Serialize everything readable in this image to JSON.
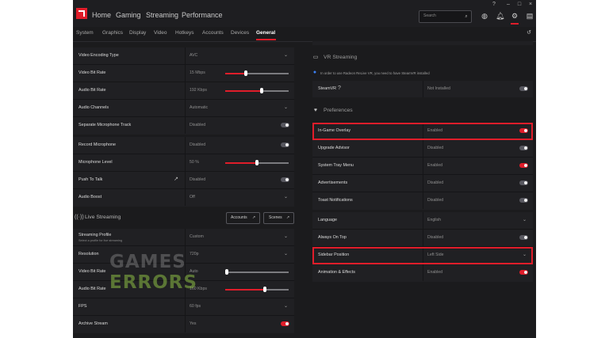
{
  "topnav": [
    "Home",
    "Gaming",
    "Streaming",
    "Performance"
  ],
  "search_placeholder": "Search",
  "subnav": [
    "System",
    "Graphics",
    "Display",
    "Video",
    "Hotkeys",
    "Accounts",
    "Devices",
    "General"
  ],
  "left": {
    "recording": [
      {
        "label": "Video Encoding Type",
        "value": "AVC"
      },
      {
        "label": "Video Bit Rate",
        "value": "15 Mbps",
        "level": 0.32
      },
      {
        "label": "Audio Bit Rate",
        "value": "192 Kbps",
        "level": 0.58
      },
      {
        "label": "Audio Channels",
        "value": "Automatic"
      },
      {
        "label": "Separate Microphone Track",
        "value": "Disabled"
      }
    ],
    "mic": [
      {
        "label": "Record Microphone",
        "value": "Disabled"
      },
      {
        "label": "Microphone Level",
        "value": "50 %",
        "level": 0.5
      },
      {
        "label": "Push To Talk",
        "value": "Disabled"
      },
      {
        "label": "Audio Boost",
        "value": "Off"
      }
    ],
    "live_title": "Live Streaming",
    "accounts_btn": "Accounts",
    "scenes_btn": "Scenes",
    "live": [
      {
        "label": "Streaming Profile",
        "sub": "Select a profile for live streaming",
        "value": "Custom"
      },
      {
        "label": "Resolution",
        "value": "720p"
      },
      {
        "label": "Video Bit Rate",
        "value": "Auto",
        "level": 0.02
      },
      {
        "label": "Audio Bit Rate",
        "value": "160 Kbps",
        "level": 0.63
      },
      {
        "label": "FPS",
        "value": "60 fps"
      },
      {
        "label": "Archive Stream",
        "value": "Yes",
        "toggle": "on"
      }
    ]
  },
  "right": {
    "vr_title": "VR Streaming",
    "vr_info": "In order to use Radeon ReLive VR, you need to have SteamVR installed",
    "steamvr": {
      "label": "SteamVR",
      "value": "Not Installed"
    },
    "pref_title": "Preferences",
    "prefs": [
      {
        "label": "In-Game Overlay",
        "value": "Enabled",
        "toggle": "on"
      },
      {
        "label": "Upgrade Advisor",
        "value": "Disabled",
        "toggle": "off"
      },
      {
        "label": "System Tray Menu",
        "value": "Enabled",
        "toggle": "on"
      },
      {
        "label": "Advertisements",
        "value": "Disabled",
        "toggle": "off"
      },
      {
        "label": "Toast Notifications",
        "value": "Disabled",
        "toggle": "off"
      }
    ],
    "lang": [
      {
        "label": "Language",
        "value": "English"
      },
      {
        "label": "Always On Top",
        "value": "Disabled"
      },
      {
        "label": "Sidebar Position",
        "value": "Left Side"
      },
      {
        "label": "Animation & Effects",
        "value": "Enabled"
      }
    ]
  },
  "watermark": {
    "line1": "GAMES",
    "line2": "ERRORS"
  },
  "colors": {
    "accent": "#e01d2a",
    "background": "#1b1b1d",
    "panel": "#202023"
  }
}
